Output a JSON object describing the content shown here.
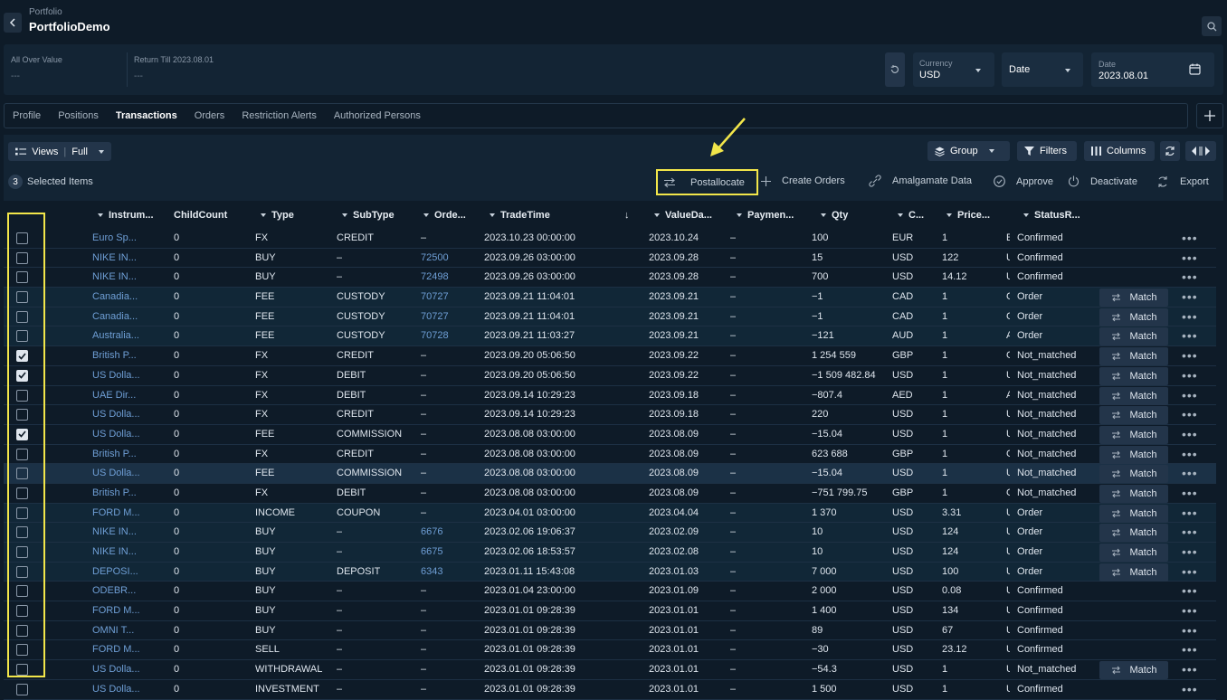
{
  "header": {
    "breadcrumb": "Portfolio",
    "title": "PortfolioDemo"
  },
  "summary": {
    "all_over_value": {
      "label": "All Over Value",
      "value": "---"
    },
    "return_till": {
      "label": "Return Till 2023.08.01",
      "value": "---"
    },
    "currency": {
      "label": "Currency",
      "value": "USD"
    },
    "date_type": {
      "value": "Date"
    },
    "date": {
      "label": "Date",
      "value": "2023.08.01"
    }
  },
  "tabs": [
    "Profile",
    "Positions",
    "Transactions",
    "Orders",
    "Restriction Alerts",
    "Authorized Persons"
  ],
  "active_tab": "Transactions",
  "toolbar": {
    "views": "Views",
    "views_value": "Full",
    "group": "Group",
    "filters": "Filters",
    "columns": "Columns",
    "selected_count": "3",
    "selected_label": "Selected Items",
    "postallocate": "Postallocate",
    "create_orders": "Create Orders",
    "amalgamate": "Amalgamate Data",
    "approve": "Approve",
    "deactivate": "Deactivate",
    "export": "Export"
  },
  "columns": [
    "Instrum...",
    "ChildCount",
    "Type",
    "SubType",
    "Orde...",
    "TradeTime",
    "ValueDa...",
    "Paymen...",
    "Qty",
    "C...",
    "Price...",
    "StatusR..."
  ],
  "match_label": "Match",
  "rows": [
    {
      "instr": "Euro Sp...",
      "child": "0",
      "type": "FX",
      "subtype": "CREDIT",
      "order": "–",
      "trade": "2023.10.23 00:00:00",
      "value": "2023.10.24",
      "pay": "–",
      "qty": "100",
      "cur": "EUR",
      "price": "1",
      "r": "E",
      "status": "Confirmed",
      "checked": false,
      "match": false
    },
    {
      "instr": "NIKE IN...",
      "child": "0",
      "type": "BUY",
      "subtype": "–",
      "order": "72500",
      "trade": "2023.09.26 03:00:00",
      "value": "2023.09.28",
      "pay": "–",
      "qty": "15",
      "cur": "USD",
      "price": "122",
      "r": "U",
      "status": "Confirmed",
      "checked": false,
      "match": false
    },
    {
      "instr": "NIKE IN...",
      "child": "0",
      "type": "BUY",
      "subtype": "–",
      "order": "72498",
      "trade": "2023.09.26 03:00:00",
      "value": "2023.09.28",
      "pay": "–",
      "qty": "700",
      "cur": "USD",
      "price": "14.12",
      "r": "U",
      "status": "Confirmed",
      "checked": false,
      "match": false
    },
    {
      "instr": "Canadia...",
      "child": "0",
      "type": "FEE",
      "subtype": "CUSTODY",
      "order": "70727",
      "trade": "2023.09.21 11:04:01",
      "value": "2023.09.21",
      "pay": "–",
      "qty": "−1",
      "cur": "CAD",
      "price": "1",
      "r": "C",
      "status": "Order",
      "checked": false,
      "match": true
    },
    {
      "instr": "Canadia...",
      "child": "0",
      "type": "FEE",
      "subtype": "CUSTODY",
      "order": "70727",
      "trade": "2023.09.21 11:04:01",
      "value": "2023.09.21",
      "pay": "–",
      "qty": "−1",
      "cur": "CAD",
      "price": "1",
      "r": "C",
      "status": "Order",
      "checked": false,
      "match": true
    },
    {
      "instr": "Australia...",
      "child": "0",
      "type": "FEE",
      "subtype": "CUSTODY",
      "order": "70728",
      "trade": "2023.09.21 11:03:27",
      "value": "2023.09.21",
      "pay": "–",
      "qty": "−121",
      "cur": "AUD",
      "price": "1",
      "r": "A",
      "status": "Order",
      "checked": false,
      "match": true
    },
    {
      "instr": "British P...",
      "child": "0",
      "type": "FX",
      "subtype": "CREDIT",
      "order": "–",
      "trade": "2023.09.20 05:06:50",
      "value": "2023.09.22",
      "pay": "–",
      "qty": "1 254 559",
      "cur": "GBP",
      "price": "1",
      "r": "G",
      "status": "Not_matched",
      "checked": true,
      "match": true
    },
    {
      "instr": "US Dolla...",
      "child": "0",
      "type": "FX",
      "subtype": "DEBIT",
      "order": "–",
      "trade": "2023.09.20 05:06:50",
      "value": "2023.09.22",
      "pay": "–",
      "qty": "−1 509 482.84",
      "cur": "USD",
      "price": "1",
      "r": "U",
      "status": "Not_matched",
      "checked": true,
      "match": true
    },
    {
      "instr": "UAE Dir...",
      "child": "0",
      "type": "FX",
      "subtype": "DEBIT",
      "order": "–",
      "trade": "2023.09.14 10:29:23",
      "value": "2023.09.18",
      "pay": "–",
      "qty": "−807.4",
      "cur": "AED",
      "price": "1",
      "r": "A",
      "status": "Not_matched",
      "checked": false,
      "match": true
    },
    {
      "instr": "US Dolla...",
      "child": "0",
      "type": "FX",
      "subtype": "CREDIT",
      "order": "–",
      "trade": "2023.09.14 10:29:23",
      "value": "2023.09.18",
      "pay": "–",
      "qty": "220",
      "cur": "USD",
      "price": "1",
      "r": "U",
      "status": "Not_matched",
      "checked": false,
      "match": true
    },
    {
      "instr": "US Dolla...",
      "child": "0",
      "type": "FEE",
      "subtype": "COMMISSION",
      "order": "–",
      "trade": "2023.08.08 03:00:00",
      "value": "2023.08.09",
      "pay": "–",
      "qty": "−15.04",
      "cur": "USD",
      "price": "1",
      "r": "U",
      "status": "Not_matched",
      "checked": true,
      "match": true
    },
    {
      "instr": "British P...",
      "child": "0",
      "type": "FX",
      "subtype": "CREDIT",
      "order": "–",
      "trade": "2023.08.08 03:00:00",
      "value": "2023.08.09",
      "pay": "–",
      "qty": "623 688",
      "cur": "GBP",
      "price": "1",
      "r": "G",
      "status": "Not_matched",
      "checked": false,
      "match": true
    },
    {
      "instr": "US Dolla...",
      "child": "0",
      "type": "FEE",
      "subtype": "COMMISSION",
      "order": "–",
      "trade": "2023.08.08 03:00:00",
      "value": "2023.08.09",
      "pay": "–",
      "qty": "−15.04",
      "cur": "USD",
      "price": "1",
      "r": "U",
      "status": "Not_matched",
      "checked": false,
      "match": true
    },
    {
      "instr": "British P...",
      "child": "0",
      "type": "FX",
      "subtype": "DEBIT",
      "order": "–",
      "trade": "2023.08.08 03:00:00",
      "value": "2023.08.09",
      "pay": "–",
      "qty": "−751 799.75",
      "cur": "GBP",
      "price": "1",
      "r": "G",
      "status": "Not_matched",
      "checked": false,
      "match": true
    },
    {
      "instr": "FORD M...",
      "child": "0",
      "type": "INCOME",
      "subtype": "COUPON",
      "order": "–",
      "trade": "2023.04.01 03:00:00",
      "value": "2023.04.04",
      "pay": "–",
      "qty": "1 370",
      "cur": "USD",
      "price": "3.31",
      "r": "U",
      "status": "Order",
      "checked": false,
      "match": true
    },
    {
      "instr": "NIKE IN...",
      "child": "0",
      "type": "BUY",
      "subtype": "–",
      "order": "6676",
      "trade": "2023.02.06 19:06:37",
      "value": "2023.02.09",
      "pay": "–",
      "qty": "10",
      "cur": "USD",
      "price": "124",
      "r": "U",
      "status": "Order",
      "checked": false,
      "match": true
    },
    {
      "instr": "NIKE IN...",
      "child": "0",
      "type": "BUY",
      "subtype": "–",
      "order": "6675",
      "trade": "2023.02.06 18:53:57",
      "value": "2023.02.08",
      "pay": "–",
      "qty": "10",
      "cur": "USD",
      "price": "124",
      "r": "U",
      "status": "Order",
      "checked": false,
      "match": true
    },
    {
      "instr": "DEPOSI...",
      "child": "0",
      "type": "BUY",
      "subtype": "DEPOSIT",
      "order": "6343",
      "trade": "2023.01.11 15:43:08",
      "value": "2023.01.03",
      "pay": "–",
      "qty": "7 000",
      "cur": "USD",
      "price": "100",
      "r": "U",
      "status": "Order",
      "checked": false,
      "match": true
    },
    {
      "instr": "ODEBR...",
      "child": "0",
      "type": "BUY",
      "subtype": "–",
      "order": "–",
      "trade": "2023.01.04 23:00:00",
      "value": "2023.01.09",
      "pay": "–",
      "qty": "2 000",
      "cur": "USD",
      "price": "0.08",
      "r": "U",
      "status": "Confirmed",
      "checked": false,
      "match": false
    },
    {
      "instr": "FORD M...",
      "child": "0",
      "type": "BUY",
      "subtype": "–",
      "order": "–",
      "trade": "2023.01.01 09:28:39",
      "value": "2023.01.01",
      "pay": "–",
      "qty": "1 400",
      "cur": "USD",
      "price": "134",
      "r": "U",
      "status": "Confirmed",
      "checked": false,
      "match": false
    },
    {
      "instr": "OMNI T...",
      "child": "0",
      "type": "BUY",
      "subtype": "–",
      "order": "–",
      "trade": "2023.01.01 09:28:39",
      "value": "2023.01.01",
      "pay": "–",
      "qty": "89",
      "cur": "USD",
      "price": "67",
      "r": "U",
      "status": "Confirmed",
      "checked": false,
      "match": false
    },
    {
      "instr": "FORD M...",
      "child": "0",
      "type": "SELL",
      "subtype": "–",
      "order": "–",
      "trade": "2023.01.01 09:28:39",
      "value": "2023.01.01",
      "pay": "–",
      "qty": "−30",
      "cur": "USD",
      "price": "23.12",
      "r": "U",
      "status": "Confirmed",
      "checked": false,
      "match": false
    },
    {
      "instr": "US Dolla...",
      "child": "0",
      "type": "WITHDRAWAL",
      "subtype": "–",
      "order": "–",
      "trade": "2023.01.01 09:28:39",
      "value": "2023.01.01",
      "pay": "–",
      "qty": "−54.3",
      "cur": "USD",
      "price": "1",
      "r": "U",
      "status": "Not_matched",
      "checked": false,
      "match": true
    },
    {
      "instr": "US Dolla...",
      "child": "0",
      "type": "INVESTMENT",
      "subtype": "–",
      "order": "–",
      "trade": "2023.01.01 09:28:39",
      "value": "2023.01.01",
      "pay": "–",
      "qty": "1 500",
      "cur": "USD",
      "price": "1",
      "r": "U",
      "status": "Confirmed",
      "checked": false,
      "match": false
    }
  ]
}
